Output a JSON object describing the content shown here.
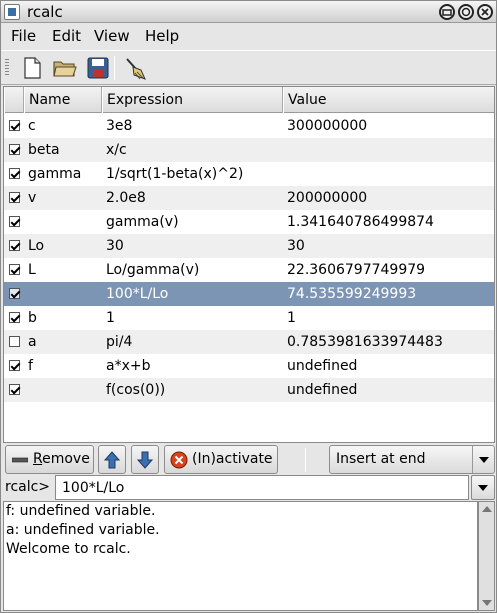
{
  "window": {
    "title": "rcalc"
  },
  "menu": [
    "File",
    "Edit",
    "View",
    "Help"
  ],
  "toolbar": {
    "icons": [
      "new-document-icon",
      "open-folder-icon",
      "save-icon",
      "clear-broom-icon"
    ]
  },
  "table": {
    "columns": [
      "Name",
      "Expression",
      "Value"
    ],
    "rows": [
      {
        "checked": true,
        "name": "c",
        "expression": "3e8",
        "value": "300000000"
      },
      {
        "checked": true,
        "name": "beta",
        "expression": "x/c",
        "value": ""
      },
      {
        "checked": true,
        "name": "gamma",
        "expression": "1/sqrt(1-beta(x)^2)",
        "value": ""
      },
      {
        "checked": true,
        "name": "v",
        "expression": "2.0e8",
        "value": "200000000"
      },
      {
        "checked": true,
        "name": "",
        "expression": "gamma(v)",
        "value": "1.341640786499874"
      },
      {
        "checked": true,
        "name": "Lo",
        "expression": "30",
        "value": "30"
      },
      {
        "checked": true,
        "name": "L",
        "expression": "Lo/gamma(v)",
        "value": "22.3606797749979"
      },
      {
        "checked": true,
        "name": "",
        "expression": "100*L/Lo",
        "value": "74.535599249993",
        "selected": true
      },
      {
        "checked": true,
        "name": "b",
        "expression": "1",
        "value": "1"
      },
      {
        "checked": false,
        "name": "a",
        "expression": "pi/4",
        "value": "0.7853981633974483"
      },
      {
        "checked": true,
        "name": "f",
        "expression": "a*x+b",
        "value": "undefined"
      },
      {
        "checked": true,
        "name": "",
        "expression": "f(cos(0))",
        "value": "undefined"
      }
    ]
  },
  "actions": {
    "remove_label": "Remove",
    "inactivate_label": "(In)activate",
    "insert_mode": "Insert at end"
  },
  "prompt": {
    "label": "rcalc>",
    "value": "100*L/Lo"
  },
  "output": [
    "f: undefined variable.",
    "a: undefined variable.",
    "Welcome to rcalc."
  ]
}
